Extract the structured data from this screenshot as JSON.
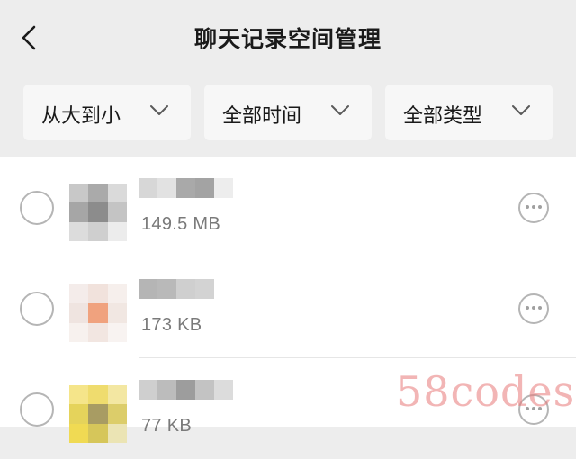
{
  "header": {
    "title": "聊天记录空间管理",
    "back_icon": "chevron-left-icon"
  },
  "filters": [
    {
      "label": "从大到小",
      "icon": "chevron-down-icon"
    },
    {
      "label": "全部时间",
      "icon": "chevron-down-icon"
    },
    {
      "label": "全部类型",
      "icon": "chevron-down-icon"
    }
  ],
  "list": {
    "items": [
      {
        "size": "149.5 MB",
        "selected": false,
        "more_icon": "more-icon",
        "thumb_colors": [
          "#c8c8c8",
          "#aaaaaa",
          "#dadada",
          "#a6a6a6",
          "#8c8c8c",
          "#c4c4c4",
          "#dcdcdc",
          "#cfcfcf",
          "#ececec"
        ],
        "name_colors": [
          "#d7d7d7",
          "#e2e2e2",
          "#a9a9a9",
          "#a3a3a3",
          "#ededed"
        ]
      },
      {
        "size": "173 KB",
        "selected": false,
        "more_icon": "more-icon",
        "thumb_colors": [
          "#f4ecea",
          "#f1e2dc",
          "#f6efec",
          "#efe4e0",
          "#f0a27e",
          "#f1e7e2",
          "#f7f1ee",
          "#f2e6e1",
          "#f8f3f1"
        ],
        "name_colors": [
          "#b5b5b5",
          "#b9b9b9",
          "#cfcfcf",
          "#d3d3d3"
        ]
      },
      {
        "size": "77 KB",
        "selected": false,
        "more_icon": "more-icon",
        "thumb_colors": [
          "#f5e58a",
          "#efdc6e",
          "#f3e7a2",
          "#e5d35b",
          "#a89c63",
          "#dccd6a",
          "#f0da53",
          "#d6c65a",
          "#ebe4b4"
        ],
        "name_colors": [
          "#cfcfcf",
          "#bcbcbc",
          "#9d9d9d",
          "#c3c3c3",
          "#dcdcdc"
        ]
      }
    ]
  },
  "watermark": "58codes",
  "colors": {
    "background": "#ededed",
    "card": "#ffffff",
    "filter_bg": "#f7f7f7",
    "secondary_text": "#7a7a7a",
    "watermark": "#e87878"
  }
}
